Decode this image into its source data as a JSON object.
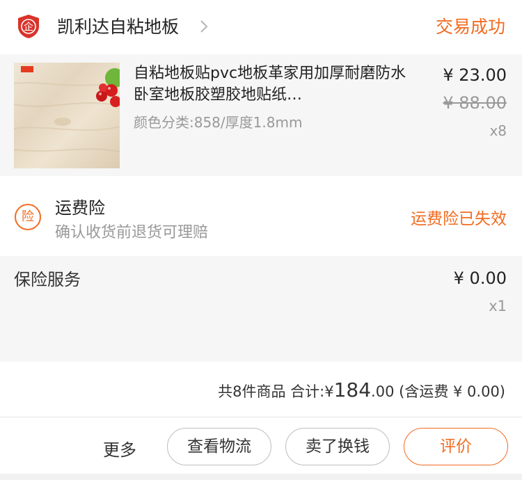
{
  "shop": {
    "icon": "enterprise-shop-icon",
    "icon_glyph": "企",
    "name": "凯利达自粘地板",
    "chevron_icon": "chevron-right-icon"
  },
  "order": {
    "status": "交易成功"
  },
  "item": {
    "title": "自粘地板贴pvc地板革家用加厚耐磨防水卧室地板胶塑胶地贴纸…",
    "sku": "颜色分类:858/厚度1.8mm",
    "price": "¥ 23.00",
    "original_price": "¥ 88.00",
    "quantity": "x8"
  },
  "shipping_insurance": {
    "icon_glyph": "险",
    "title": "运费险",
    "subtitle": "确认收货前退货可理赔",
    "status": "运费险已失效"
  },
  "insurance_service": {
    "title": "保险服务",
    "price": "¥ 0.00",
    "quantity": "x1"
  },
  "summary": {
    "count": "共8件商品",
    "total_label": "合计:",
    "currency": "¥",
    "total_int": "184",
    "total_dec": ".00",
    "shipping_note": "(含运费 ¥ 0.00)"
  },
  "actions": {
    "more": "更多",
    "logistics": "查看物流",
    "sell": "卖了换钱",
    "review": "评价"
  },
  "colors": {
    "accent": "#f26b21",
    "shop_icon": "#d9342b",
    "muted": "#999999"
  }
}
